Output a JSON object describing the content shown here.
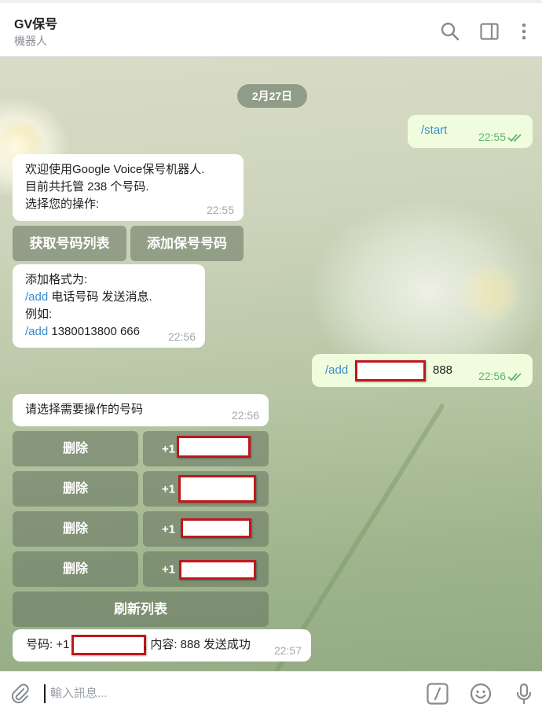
{
  "header": {
    "title": "GV保号",
    "subtitle": "機器人",
    "icons": [
      "search-icon",
      "sidebar-toggle-icon",
      "more-vertical-icon"
    ]
  },
  "chat": {
    "date_label": "2月27日",
    "messages": {
      "start": {
        "text": "/start",
        "time": "22:55"
      },
      "welcome": {
        "line1": "欢迎使用Google Voice保号机器人.",
        "line2": "目前共托管 238 个号码.",
        "line3": "选择您的操作:",
        "time": "22:55"
      },
      "welcome_buttons": {
        "get_list": "获取号码列表",
        "add": "添加保号号码"
      },
      "format": {
        "line1": "添加格式为:",
        "line2_cmd": "/add",
        "line2_rest": " 电话号码 发送消息.",
        "line3": "例如:",
        "line4_cmd": "/add",
        "line4_rest": " 1380013800 666",
        "time": "22:56"
      },
      "add_cmd": {
        "cmd": "/add",
        "tail": "888",
        "time": "22:56"
      },
      "select": {
        "text": "请选择需要操作的号码",
        "time": "22:56"
      },
      "number_buttons": {
        "delete_label": "删除",
        "prefix": "+1",
        "refresh_label": "刷新列表"
      },
      "result": {
        "prefix": "号码: +1",
        "suffix": ", 内容: 888 发送成功",
        "time": "22:57"
      }
    }
  },
  "composer": {
    "placeholder": "輸入訊息..."
  },
  "colors": {
    "outgoing_bubble": "#effdde",
    "incoming_bubble": "#ffffff",
    "link_command": "#3b8ccc",
    "read_check": "#5fb36a",
    "redaction_border": "#c0171b"
  }
}
